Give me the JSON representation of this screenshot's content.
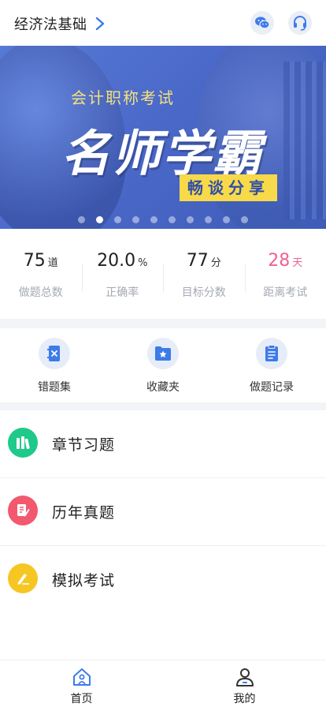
{
  "header": {
    "subject": "经济法基础",
    "wechat_icon": "wechat-icon",
    "service_icon": "headset-icon"
  },
  "banner": {
    "kicker": "会计职称考试",
    "headline": "名师学霸",
    "tag": "畅谈分享",
    "slide_count": 10,
    "active_slide": 2
  },
  "stats": [
    {
      "value": "75",
      "unit": "道",
      "label": "做题总数"
    },
    {
      "value": "20.0",
      "unit": "%",
      "label": "正确率"
    },
    {
      "value": "77",
      "unit": "分",
      "label": "目标分数"
    },
    {
      "value": "28",
      "unit": "天",
      "label": "距离考试"
    }
  ],
  "tools": [
    {
      "label": "错题集",
      "icon": "wrong-book-icon"
    },
    {
      "label": "收藏夹",
      "icon": "star-folder-icon"
    },
    {
      "label": "做题记录",
      "icon": "clipboard-icon"
    }
  ],
  "practice": [
    {
      "label": "章节习题",
      "icon": "books-icon",
      "color": "#1fc98a"
    },
    {
      "label": "历年真题",
      "icon": "paper-pen-icon",
      "color": "#f2596e"
    },
    {
      "label": "模拟考试",
      "icon": "pencil-icon",
      "color": "#f6c623"
    }
  ],
  "tabbar": {
    "items": [
      {
        "label": "首页",
        "icon": "home-icon",
        "active": true
      },
      {
        "label": "我的",
        "icon": "user-icon",
        "active": false
      }
    ]
  },
  "colors": {
    "accent": "#3d7be8",
    "exam_countdown": "#f06192",
    "divider": "#f3f4f8"
  }
}
